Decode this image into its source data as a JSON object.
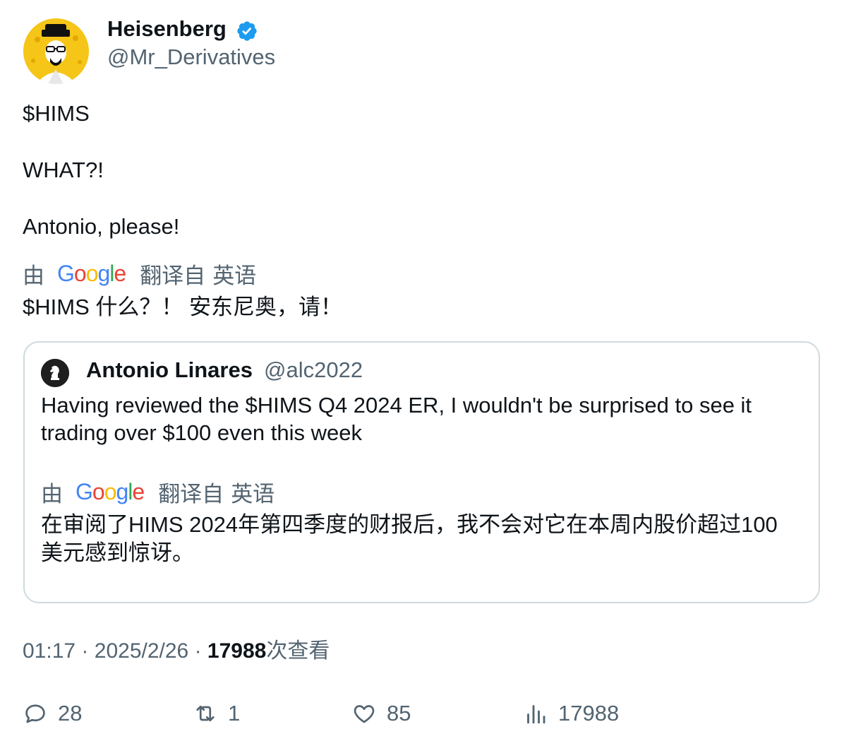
{
  "author": {
    "display_name": "Heisenberg",
    "handle": "@Mr_Derivatives",
    "verified": true,
    "avatar_icon": "heisenberg-avatar-icon"
  },
  "tweet": {
    "lines": [
      "$HIMS",
      "WHAT?!",
      "Antonio, please!"
    ],
    "translation": {
      "by_label": "由",
      "provider": "Google",
      "translated_from_label": "翻译自",
      "language": "英语",
      "text": "$HIMS 什么？！ 安东尼奥，请！"
    }
  },
  "quote": {
    "display_name": "Antonio Linares",
    "handle": "@alc2022",
    "lines": [
      "Having reviewed the $HIMS Q4 2024 ER, I wouldn't be surprised to see it",
      "trading over $100 even this week"
    ],
    "translation": {
      "by_label": "由",
      "provider": "Google",
      "translated_from_label": "翻译自",
      "language": "英语",
      "lines": [
        "在审阅了HIMS 2024年第四季度的财报后，我不会对它在本周内股价超过100",
        "美元感到惊讶。"
      ]
    }
  },
  "meta": {
    "time": "01:17",
    "separator": "·",
    "date": "2025/2/26",
    "views": "17988",
    "views_label": "次查看"
  },
  "actions": {
    "replies": "28",
    "retweets": "1",
    "likes": "85",
    "views": "17988"
  },
  "colors": {
    "text": "#0f1419",
    "secondary": "#536471",
    "border": "#cfd9de",
    "verified": "#1d9bf0"
  }
}
